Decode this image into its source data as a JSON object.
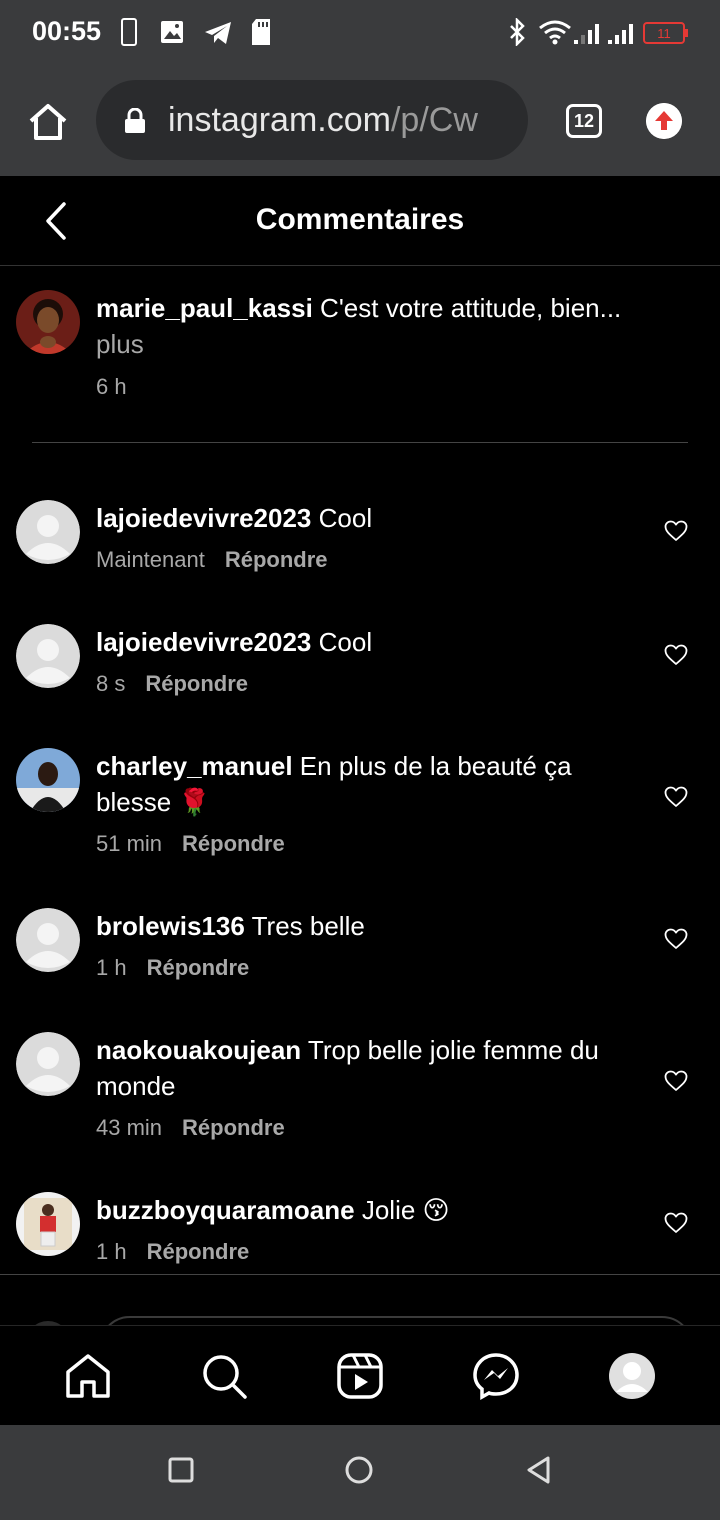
{
  "status_bar": {
    "time": "00:55",
    "battery_level": "11"
  },
  "browser": {
    "url_host": "instagram.com",
    "url_path": "/p/Cw",
    "tab_count": "12"
  },
  "header": {
    "title": "Commentaires"
  },
  "caption": {
    "username": "marie_paul_kassi",
    "text": "C'est votre attitude, bien...",
    "more_label": "plus",
    "time": "6 h"
  },
  "reply_label": "Répondre",
  "comments": [
    {
      "username": "lajoiedevivre2023",
      "text": "Cool",
      "time": "Maintenant",
      "reply": "Répondre",
      "avatar": "default"
    },
    {
      "username": "lajoiedevivre2023",
      "text": "Cool",
      "time": "8 s",
      "reply": "Répondre",
      "avatar": "default"
    },
    {
      "username": "charley_manuel",
      "text": "En plus de la beauté ça blesse 🌹",
      "time": "51 min",
      "reply": "Répondre",
      "avatar": "photo"
    },
    {
      "username": "brolewis136",
      "text": "Tres belle",
      "time": "1 h",
      "reply": "Répondre",
      "avatar": "default"
    },
    {
      "username": "naokouakoujean",
      "text": "Trop belle jolie femme du monde",
      "time": "43 min",
      "reply": "Répondre",
      "avatar": "default"
    },
    {
      "username": "buzzboyquaramoane",
      "text": "Jolie 😚",
      "time": "1 h",
      "reply": "Répondre",
      "avatar": "photo"
    }
  ],
  "bottom_nav": [
    {
      "icon": "home-icon"
    },
    {
      "icon": "search-icon"
    },
    {
      "icon": "reels-icon"
    },
    {
      "icon": "messenger-icon"
    },
    {
      "icon": "profile-icon"
    }
  ],
  "colors": {
    "background": "#000000",
    "chrome": "#3a3b3d",
    "secondary_text": "#a8a8a8",
    "battery_low": "#e53935"
  }
}
